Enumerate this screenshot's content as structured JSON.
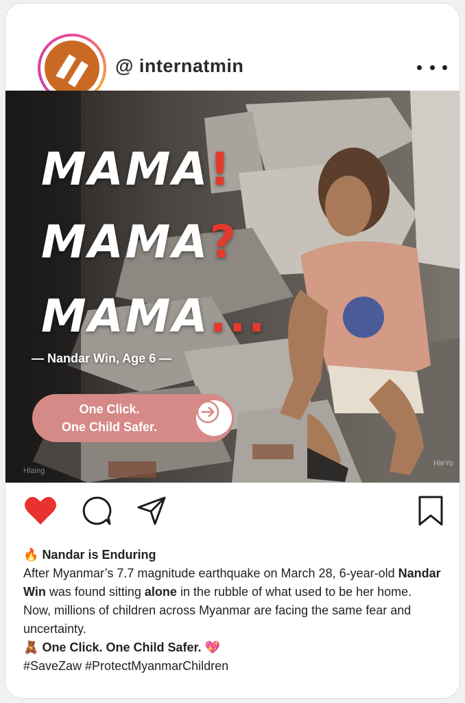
{
  "post": {
    "username": "@ internatmin"
  },
  "image": {
    "mama_lines": [
      {
        "word": "MAMA",
        "punct": "!"
      },
      {
        "word": "MAMA",
        "punct": "?"
      },
      {
        "word": "MAMA",
        "punct": "..."
      }
    ],
    "attribution": "— Nandar Win, Age 6 —",
    "cta": {
      "line1": "One Click.",
      "line2": "One Child Safer."
    },
    "watermark_left": "Hlaing",
    "watermark_right": "HleYo"
  },
  "caption": {
    "title_emoji": "🔥",
    "title": "Nandar is Enduring",
    "p1_a": "After Myanmar’s 7.7 magnitude earthquake on March 28, 6-year-old ",
    "p1_bold1": "Nandar Win",
    "p1_b": " was found sitting ",
    "p1_bold2": "alone",
    "p1_c": " in the rubble of what used to be her home.",
    "p2": "Now, millions of children across Myanmar are facing the same fear and uncertainty.",
    "cta_emoji": "🧸",
    "cta_text": "One Click. One Child Safer.",
    "cta_heart": "💖",
    "hashtags": "#SaveZaw #ProtectMyanmarChildren"
  },
  "colors": {
    "like": "#e8322f",
    "cta_pill": "#d58a88",
    "accent_red": "#e23a2c",
    "avatar_orange": "#c96a24"
  },
  "icons": [
    "heart-icon",
    "comment-icon",
    "share-icon",
    "bookmark-icon",
    "more-icon",
    "arrow-right-icon"
  ]
}
